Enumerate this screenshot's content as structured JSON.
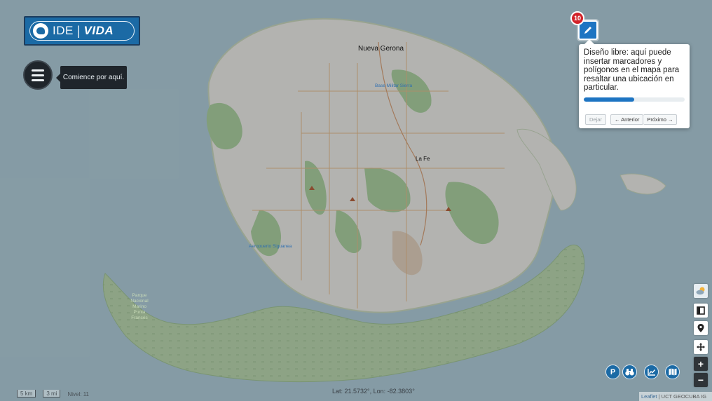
{
  "app": {
    "logo_text_ide": "IDE",
    "logo_sep": "|",
    "logo_text_vida": "VIDA",
    "colors": {
      "brand_blue": "#1b6aa5",
      "badge_red": "#d2232a",
      "land": "#efece6",
      "water": "#aecbd6",
      "forest": "#a9cf98",
      "wetland": "#b6d3a6"
    }
  },
  "menu": {
    "icon": "hamburger-icon",
    "hint_text": "Comience por aquí."
  },
  "map_labels": {
    "city_1": "Nueva Gerona",
    "city_2": "La Fe",
    "airport": "Aeropuerto Siguanea",
    "park_lines": [
      "Parque",
      "Nacional",
      "Marino",
      "Punta",
      "Francés"
    ],
    "small_place": "Base Militar Sierra"
  },
  "tour": {
    "step_number": "10",
    "target_icon": "pencil-icon",
    "text": "Diseño libre: aquí puede insertar marcadores y polígonos en el mapa para resaltar una ubicación en particular.",
    "progress_fraction": 0.5,
    "buttons": {
      "quit": "Dejar",
      "prev": "← Anterior",
      "next": "Próximo →"
    }
  },
  "right_controls": {
    "weather_icon": "weather-cloud-icon",
    "layers_icon": "layers-square-icon",
    "locate_icon": "location-pin-icon",
    "move_icon": "move-cross-icon",
    "zoom_in": "+",
    "zoom_out": "−"
  },
  "bottom_tools": [
    {
      "icon": "parking-p-icon",
      "label": "P"
    },
    {
      "icon": "binoculars-icon"
    },
    {
      "icon": "chart-line-icon"
    },
    {
      "icon": "map-folded-icon"
    }
  ],
  "status": {
    "scale_km": "5 km",
    "scale_mi": "3 mi",
    "level": "Nivel: 11",
    "coords": "Lat: 21.5732°, Lon: -82.3803°",
    "attribution_leaflet": "Leaflet",
    "attribution_org": "UCT GEOCUBA IG"
  }
}
